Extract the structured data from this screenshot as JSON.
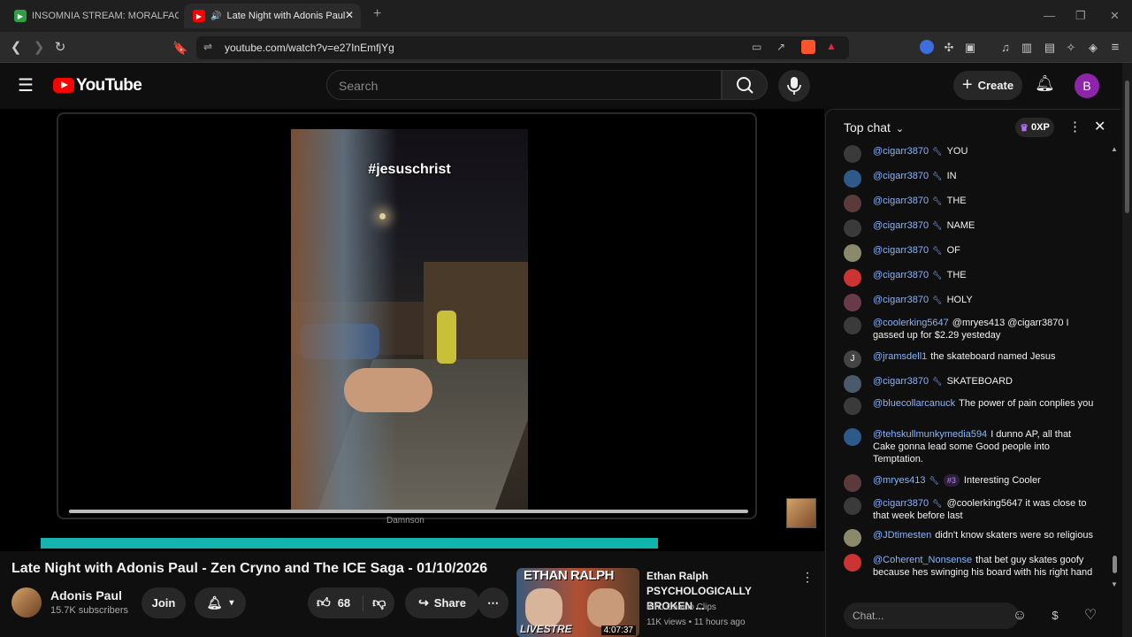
{
  "browser": {
    "tabs": [
      {
        "label": "INSOMNIA STREAM: MORALFAG EDI",
        "active": false
      },
      {
        "label": "Late Night with Adonis Paul",
        "active": true
      }
    ],
    "url": "youtube.com/watch?v=e27InEmfjYg"
  },
  "youtube": {
    "logo": "YouTube",
    "search_placeholder": "Search",
    "create_label": "Create",
    "avatar_letter": "B"
  },
  "video": {
    "overlay_hashtag": "#jesuschrist",
    "caption": "Damnson",
    "progress": 0.79,
    "title": "Late Night with Adonis Paul - Zen Cryno and The ICE Saga - 01/10/2026",
    "channel_name": "Adonis Paul",
    "subscribers": "15.7K subscribers",
    "join_label": "Join",
    "likes": "68",
    "share_label": "Share"
  },
  "recommended": {
    "thumb_text": "ETHAN RALPH",
    "thumb_bottom": "LIVESTRE",
    "duration": "4:07:37",
    "title": "Ethan Ralph PSYCHOLOGICALLY BROKEN ...",
    "channel": "Kino Casino Clips",
    "meta": "11K views • 11 hours ago"
  },
  "chat": {
    "header": "Top chat",
    "xp": "0XP",
    "input_placeholder": "Chat...",
    "messages": [
      {
        "author": "@cigarr3870",
        "mod": true,
        "text": "YOU"
      },
      {
        "author": "@cigarr3870",
        "mod": true,
        "text": "IN"
      },
      {
        "author": "@cigarr3870",
        "mod": true,
        "text": "THE"
      },
      {
        "author": "@cigarr3870",
        "mod": true,
        "text": "NAME"
      },
      {
        "author": "@cigarr3870",
        "mod": true,
        "text": "OF"
      },
      {
        "author": "@cigarr3870",
        "mod": true,
        "text": "THE"
      },
      {
        "author": "@cigarr3870",
        "mod": true,
        "text": "HOLY"
      },
      {
        "author": "@coolerking5647",
        "mod": false,
        "text": "@mryes413 @cigarr3870 I gassed up for $2.29 yesteday"
      },
      {
        "author": "@jramsdell1",
        "mod": false,
        "text": "the skateboard named Jesus",
        "avatar": "J"
      },
      {
        "author": "@cigarr3870",
        "mod": true,
        "text": "SKATEBOARD"
      },
      {
        "author": "@bluecollarcanuck",
        "mod": false,
        "text": "The power of pain conplies you"
      },
      {
        "author": "@tehskullmunkymedia594",
        "mod": false,
        "text": "I dunno AP, all that Cake gonna lead some Good people into Temptation."
      },
      {
        "author": "@mryes413",
        "mod": true,
        "badge": "#3",
        "text": "Interesting Cooler"
      },
      {
        "author": "@cigarr3870",
        "mod": true,
        "text": "@coolerking5647 it was close to that week before last"
      },
      {
        "author": "@JDtimesten",
        "mod": false,
        "text": "didn't know skaters were so religious"
      },
      {
        "author": "@Coherent_Nonsense",
        "mod": false,
        "text": "that bet guy skates goofy because hes swinging his board with his right hand"
      }
    ]
  },
  "colors": {
    "accent_red": "#ff0000",
    "link_blue": "#8ab4f8",
    "progress_teal": "#16b3b3"
  }
}
